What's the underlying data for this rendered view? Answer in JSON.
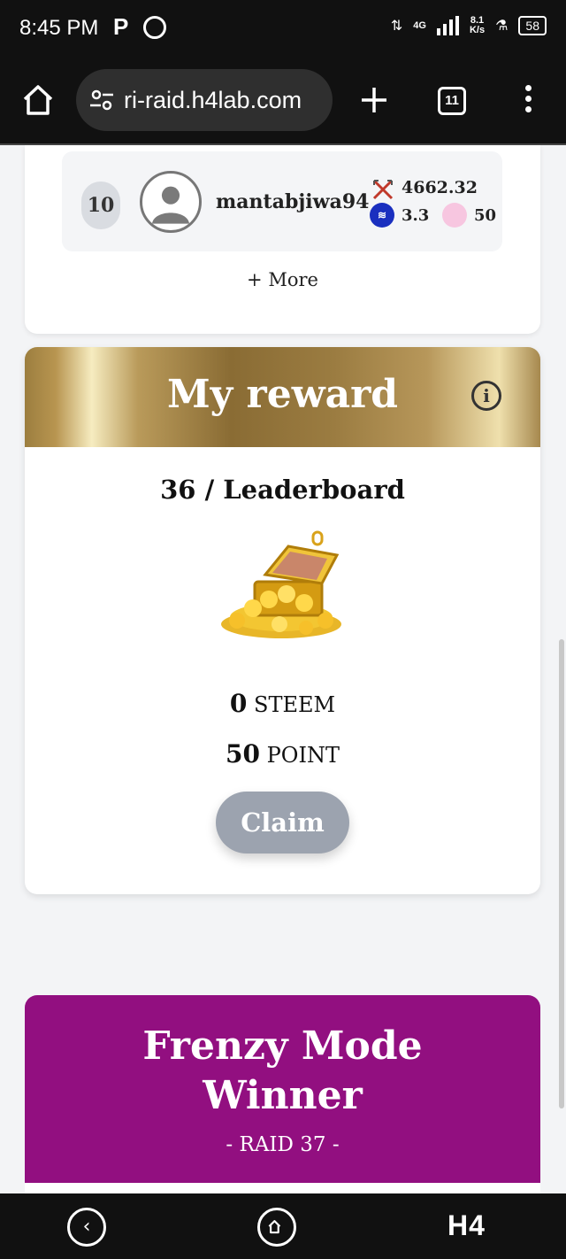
{
  "status_bar": {
    "time": "8:45 PM",
    "p_icon": "P",
    "network_type": "4G",
    "speed_value": "8.1",
    "speed_unit": "K/s",
    "battery": "58"
  },
  "browser": {
    "url": "ri-raid.h4lab.com",
    "tab_count": "11"
  },
  "leaderboard_entry": {
    "rank": "10",
    "username": "mantabjiwa94",
    "score": "4662.32",
    "steem": "3.3",
    "points": "50"
  },
  "more_label": "+ More",
  "my_reward": {
    "title": "My reward",
    "info": "i",
    "rank_text": "36 / Leaderboard",
    "steem_amount": "0",
    "steem_unit": "STEEM",
    "point_amount": "50",
    "point_unit": "POINT",
    "claim_label": "Claim"
  },
  "frenzy": {
    "title": "Frenzy Mode Winner",
    "subtitle": "- RAID 37 -"
  },
  "nav": {
    "back": "‹",
    "brand": "H4"
  },
  "colors": {
    "frenzy_bg": "#920f80",
    "claim_bg": "#9ca3af",
    "steem_blue": "#1a2fbf"
  }
}
